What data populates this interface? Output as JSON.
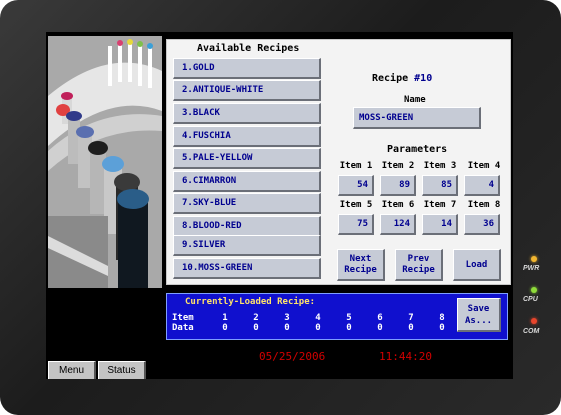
{
  "available_title": "Available Recipes",
  "recipes": [
    {
      "label": "1.GOLD"
    },
    {
      "label": "2.ANTIQUE-WHITE"
    },
    {
      "label": "3.BLACK"
    },
    {
      "label": "4.FUSCHIA"
    },
    {
      "label": "5.PALE-YELLOW"
    },
    {
      "label": "6.CIMARRON"
    },
    {
      "label": "7.SKY-BLUE"
    },
    {
      "label": "8.BLOOD-RED"
    },
    {
      "label": "9.SILVER"
    },
    {
      "label": "10.MOSS-GREEN"
    }
  ],
  "recipe_header": {
    "prefix": "Recipe ",
    "number": "#10"
  },
  "name_label": "Name",
  "name_value": "MOSS-GREEN",
  "params_label": "Parameters",
  "items": [
    {
      "label": "Item 1",
      "value": "54"
    },
    {
      "label": "Item 2",
      "value": "89"
    },
    {
      "label": "Item 3",
      "value": "85"
    },
    {
      "label": "Item 4",
      "value": "4"
    },
    {
      "label": "Item 5",
      "value": "75"
    },
    {
      "label": "Item 6",
      "value": "124"
    },
    {
      "label": "Item 7",
      "value": "14"
    },
    {
      "label": "Item 8",
      "value": "36"
    }
  ],
  "buttons": {
    "next_line1": "Next",
    "next_line2": "Recipe",
    "prev_line1": "Prev",
    "prev_line2": "Recipe",
    "load": "Load",
    "save_line1": "Save",
    "save_line2": "As..."
  },
  "loaded": {
    "title": "Currently-Loaded Recipe:",
    "item_label": "Item",
    "data_label": "Data",
    "item_numbers": [
      "1",
      "2",
      "3",
      "4",
      "5",
      "6",
      "7",
      "8"
    ],
    "data_values": [
      "0",
      "0",
      "0",
      "0",
      "0",
      "0",
      "0",
      "0"
    ]
  },
  "date": "05/25/2006",
  "time": "11:44:20",
  "tabs": {
    "menu": "Menu",
    "status": "Status"
  },
  "leds": {
    "pwr": "PWR",
    "cpu": "CPU",
    "com": "COM"
  },
  "colors": {
    "accent_blue": "#1010ce",
    "button_face": "#c6cbd6",
    "button_text": "#00008f",
    "clock_red": "#d10000",
    "led_pwr": "#f2b630",
    "led_cpu": "#8fdc3a",
    "led_com": "#e8452c"
  },
  "icons": {
    "photo": "bottle-carousel-image"
  }
}
